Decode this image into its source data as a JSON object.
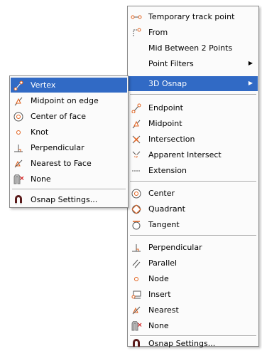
{
  "main_menu": {
    "items": [
      {
        "label": "Temporary track point"
      },
      {
        "label": "From"
      },
      {
        "label": "Mid Between 2 Points"
      },
      {
        "label": "Point Filters"
      },
      {
        "label": "3D Osnap"
      },
      {
        "label": "Endpoint"
      },
      {
        "label": "Midpoint"
      },
      {
        "label": "Intersection"
      },
      {
        "label": "Apparent Intersect"
      },
      {
        "label": "Extension"
      },
      {
        "label": "Center"
      },
      {
        "label": "Quadrant"
      },
      {
        "label": "Tangent"
      },
      {
        "label": "Perpendicular"
      },
      {
        "label": "Parallel"
      },
      {
        "label": "Node"
      },
      {
        "label": "Insert"
      },
      {
        "label": "Nearest"
      },
      {
        "label": "None"
      },
      {
        "label": "Osnap Settings..."
      }
    ]
  },
  "sub_menu": {
    "items": [
      {
        "label": "Vertex"
      },
      {
        "label": "Midpoint on edge"
      },
      {
        "label": "Center of face"
      },
      {
        "label": "Knot"
      },
      {
        "label": "Perpendicular"
      },
      {
        "label": "Nearest to Face"
      },
      {
        "label": "None"
      },
      {
        "label": "Osnap Settings..."
      }
    ]
  },
  "colors": {
    "selection": "#316ac5",
    "icon_orange": "#e0601c",
    "magnet_dark": "#5a1a1a"
  }
}
